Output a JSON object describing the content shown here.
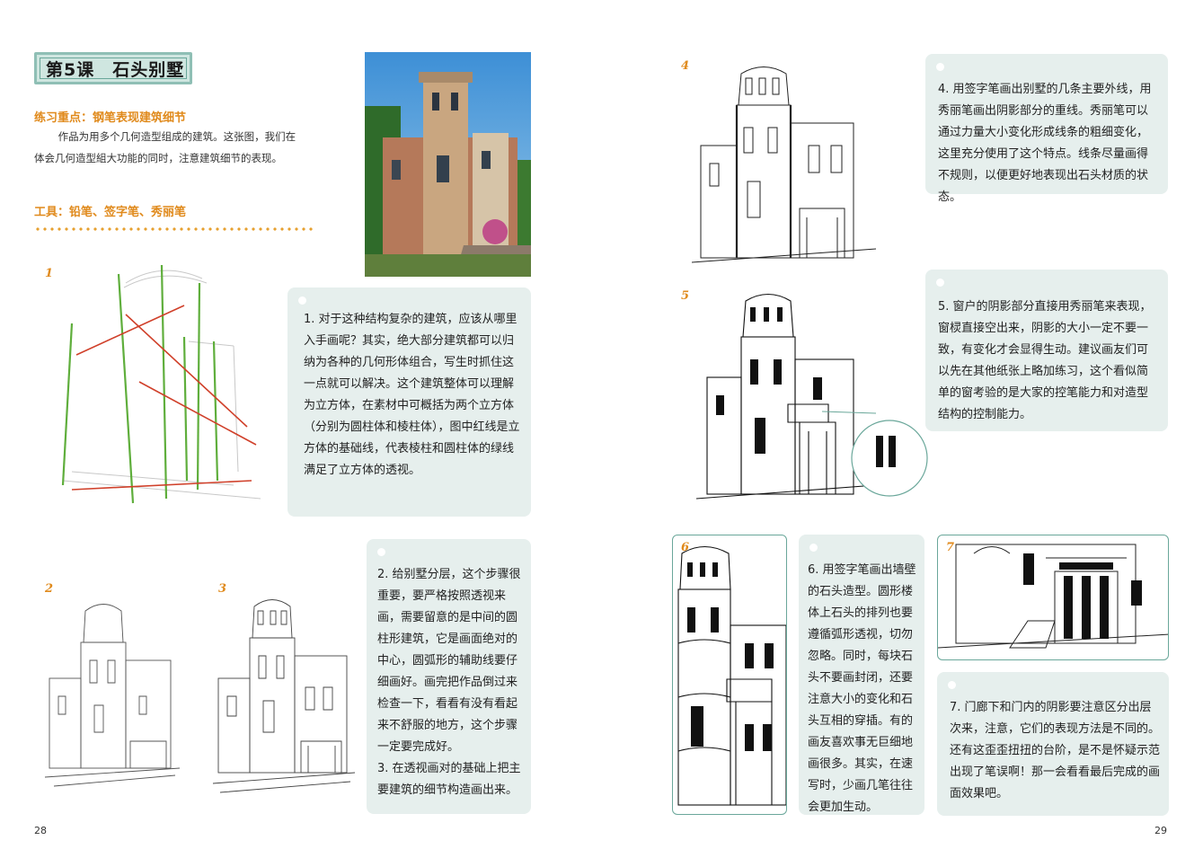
{
  "left_page": {
    "lesson_title": "第5课　石头别墅",
    "focus_label": "练习重点：钢笔表现建筑细节",
    "focus_text_line1": "　　 作品为用多个几何造型组成的建筑。这张图，我们在",
    "focus_text_line2": "体会几何造型組大功能的同时，注意建筑细节的表现。",
    "tools_label": "工具：铅笔、签字笔、秀丽笔",
    "step1_num": "1",
    "step2_num": "2",
    "step3_num": "3",
    "box1": "1. 对于这种结构复杂的建筑，应该从哪里入手画呢？其实，绝大部分建筑都可以归纳为各种的几何形体组合，写生时抓住这一点就可以解决。这个建筑整体可以理解为立方体，在素材中可概括为两个立方体（分别为圆柱体和棱柱体），图中红线是立方体的基础线，代表棱柱和圆柱体的绿线满足了立方体的透视。",
    "box2_p1": "2. 给别墅分层，这个步骤很重要，要严格按照透视来画，需要留意的是中间的圆柱形建筑，它是画面绝对的中心，圆弧形的辅助线要仔细画好。画完把作品倒过来检查一下，看看有没有看起来不舒服的地方，这个步骤一定要完成好。",
    "box2_p2": "3. 在透视画对的基础上把主要建筑的细节构造画出来。",
    "page_number": "28"
  },
  "right_page": {
    "step4_num": "4",
    "step5_num": "5",
    "step6_num": "6",
    "step7_num": "7",
    "box4": "4. 用签字笔画出别墅的几条主要外线，用秀丽笔画出阴影部分的重线。秀丽笔可以通过力量大小变化形成线条的粗细变化，这里充分使用了这个特点。线条尽量画得不规则，以便更好地表现出石头材质的状态。",
    "box5": "5. 窗户的阴影部分直接用秀丽笔来表现，窗棂直接空出来，阴影的大小一定不要一致，有变化才会显得生动。建议画友们可以先在其他纸张上略加练习，这个看似简单的窗考验的是大家的控笔能力和对造型结构的控制能力。",
    "box6": "6. 用签字笔画出墙壁的石头造型。圆形楼体上石头的排列也要遵循弧形透视，切勿忽略。同时，每块石头不要画封闭，还要注意大小的变化和石头互相的穿插。有的画友喜欢事无巨细地画很多。其实，在速写时，少画几笔往往会更加生动。",
    "box7": "7. 门廊下和门内的阴影要注意区分出层次来，注意，它们的表现方法是不同的。还有这歪歪扭扭的台阶，是不是怀疑示范出现了笔误啊！那一会看看最后完成的画面效果吧。",
    "page_number": "29"
  },
  "colors": {
    "accent_orange": "#e08a1c",
    "box_bg": "#e6efed",
    "title_bg": "#cfe6e0",
    "red_line": "#d0402a",
    "green_line": "#5fae3c"
  }
}
